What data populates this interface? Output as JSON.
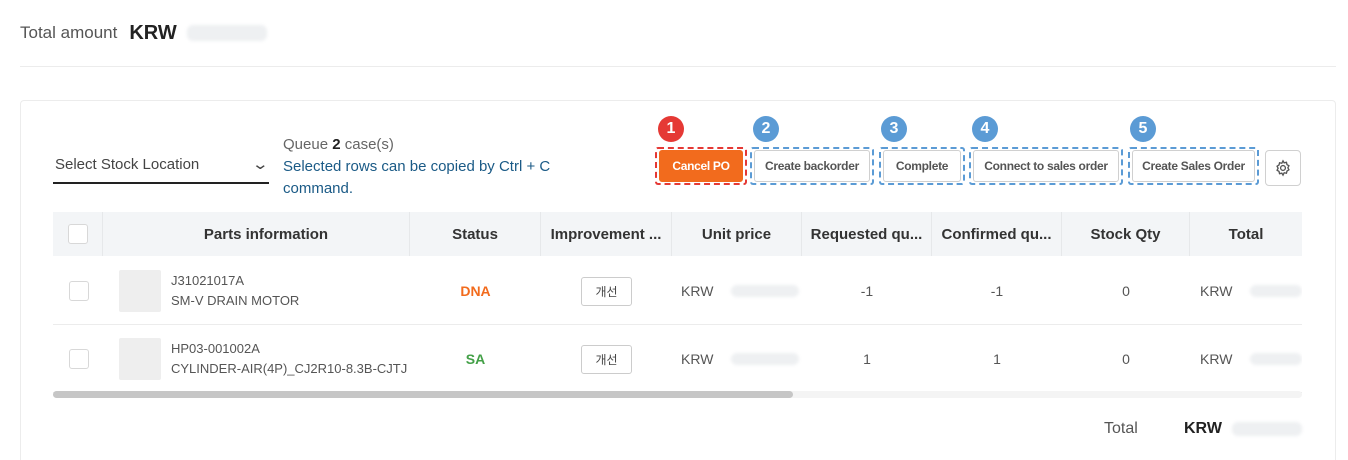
{
  "total": {
    "label": "Total amount",
    "currency": "KRW"
  },
  "stock_location": {
    "placeholder": "Select Stock Location"
  },
  "queue": {
    "prefix": "Queue",
    "count": "2",
    "suffix": "case(s)",
    "hint": "Selected rows can be copied by Ctrl + C command."
  },
  "actions": [
    {
      "num": "1",
      "label": "Cancel PO"
    },
    {
      "num": "2",
      "label": "Create backorder"
    },
    {
      "num": "3",
      "label": "Complete"
    },
    {
      "num": "4",
      "label": "Connect to sales order"
    },
    {
      "num": "5",
      "label": "Create Sales Order"
    }
  ],
  "columns": [
    "Parts information",
    "Status",
    "Improvement ...",
    "Unit price",
    "Requested qu...",
    "Confirmed qu...",
    "Stock Qty",
    "Total"
  ],
  "rows": [
    {
      "part_no": "J31021017A",
      "part_name": "SM-V DRAIN MOTOR",
      "status": "DNA",
      "improve": "개선",
      "currency": "KRW",
      "requested": "-1",
      "confirmed": "-1",
      "stock": "0",
      "total_currency": "KRW"
    },
    {
      "part_no": "HP03-001002A",
      "part_name": "CYLINDER-AIR(4P)_CJ2R10-8.3B-CJTJ",
      "status": "SA",
      "improve": "개선",
      "currency": "KRW",
      "requested": "1",
      "confirmed": "1",
      "stock": "0",
      "total_currency": "KRW"
    }
  ],
  "footer": {
    "label": "Total",
    "currency": "KRW"
  },
  "colors": {
    "primary": "#f26b1d",
    "callout_red": "#e53935",
    "callout_blue": "#5b9bd5",
    "status_dna": "#f26b1d",
    "status_sa": "#43a047",
    "link_text": "#1a5a86"
  },
  "icons": {
    "settings": "gear-icon",
    "dropdown": "chevron-down-icon"
  }
}
